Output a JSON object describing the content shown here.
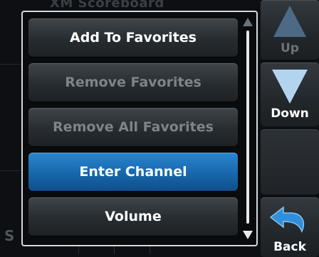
{
  "background": {
    "title": "XM Scoreboard",
    "fragment": "S"
  },
  "menu": {
    "items": [
      {
        "label": "Add To Favorites",
        "state": "enabled"
      },
      {
        "label": "Remove Favorites",
        "state": "disabled"
      },
      {
        "label": "Remove All Favorites",
        "state": "disabled"
      },
      {
        "label": "Enter Channel",
        "state": "selected"
      },
      {
        "label": "Volume",
        "state": "enabled"
      }
    ]
  },
  "softkeys": {
    "up": {
      "label": "Up",
      "state": "disabled",
      "icon": "up-arrow-icon"
    },
    "down": {
      "label": "Down",
      "state": "enabled",
      "icon": "down-arrow-icon"
    },
    "back": {
      "label": "Back",
      "state": "enabled",
      "icon": "back-arrow-icon"
    }
  },
  "colors": {
    "selected": "#1767ab",
    "down_arrow": "#b3d4ee",
    "back_arrow": "#2f8fdc"
  }
}
